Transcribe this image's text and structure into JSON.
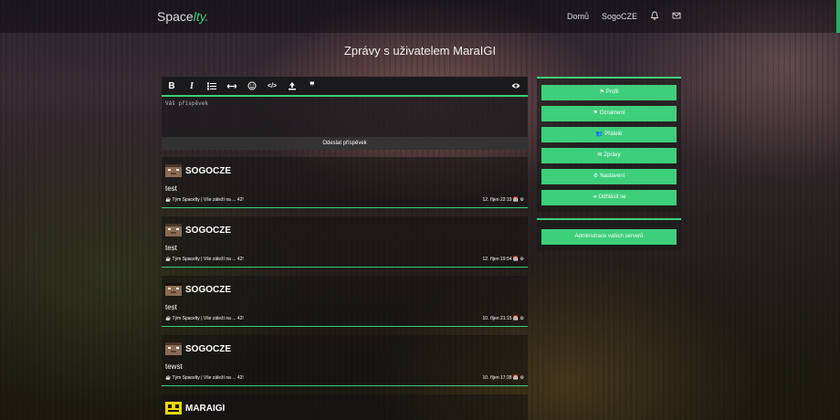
{
  "navbar": {
    "brand_main": "Space",
    "brand_accent": "lty.",
    "links": [
      "Domů",
      "SogoCZE"
    ]
  },
  "page_title": "Zprávy s uživatelem MaraIGI",
  "editor": {
    "placeholder": "Váš příspěvek",
    "submit_label": "Odeslat příspěvek",
    "toolbar": [
      "bold-icon",
      "italic-icon",
      "list-icon",
      "horizontal-rule-icon",
      "smiley-icon",
      "code-icon",
      "upload-icon",
      "quote-icon",
      "eye-icon"
    ],
    "bold_label": "B",
    "italic_label": "I",
    "code_label": "</>",
    "quote_label": "❞"
  },
  "posts": [
    {
      "author": "SOGOCZE",
      "text": "test",
      "meta": "☕ Tým Spacelty | Vše záleží na ... 42!",
      "date": "12. říjen 22:19 📅 ⚙"
    },
    {
      "author": "SOGOCZE",
      "text": "test",
      "meta": "☕ Tým Spacelty | Vše záleží na ... 42!",
      "date": "12. říjen 19:54 📅 ⚙"
    },
    {
      "author": "SOGOCZE",
      "text": "test",
      "meta": "☕ Tým Spacelty | Vše záleží na ... 42!",
      "date": "10. říjen 21:15 📅 ⚙"
    },
    {
      "author": "SOGOCZE",
      "text": "tewst",
      "meta": "☕ Tým Spacelty | Vše záleží na ... 42!",
      "date": "10. říjen 17:28 📅 ⚙"
    },
    {
      "author": "MARAIGI",
      "text": "",
      "meta": "",
      "date": ""
    }
  ],
  "sidebar": {
    "menu": [
      {
        "icon": "flag-icon",
        "glyph": "⚑",
        "label": "Profil"
      },
      {
        "icon": "flag-icon",
        "glyph": "⚑",
        "label": "Oznámení"
      },
      {
        "icon": "users-icon",
        "glyph": "👥",
        "label": "Přátelé"
      },
      {
        "icon": "mail-icon",
        "glyph": "✉",
        "label": "Zprávy"
      },
      {
        "icon": "gear-icon",
        "glyph": "⚙",
        "label": "Nastavení"
      },
      {
        "icon": "logout-icon",
        "glyph": "⇥",
        "label": "Odhlásit se"
      }
    ],
    "admin_label": "Administrace vašich serverů"
  },
  "colors": {
    "accent": "#3ecf7b"
  }
}
